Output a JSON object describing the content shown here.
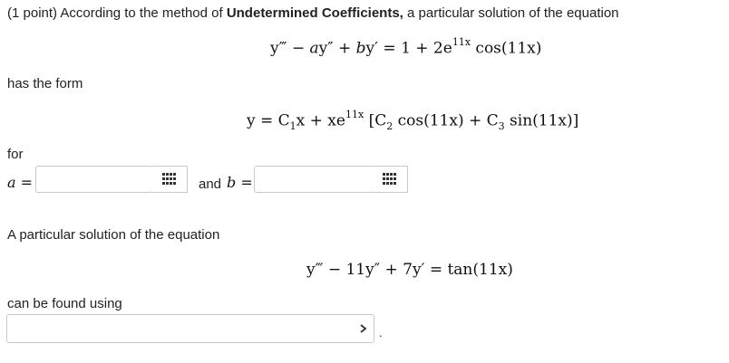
{
  "question": {
    "intro_points": "(1 point) According to the method of ",
    "intro_bold": "Undetermined Coefficients,",
    "intro_rest": " a particular solution of the equation",
    "eq1": {
      "lhs_a": "y‴ − ",
      "a": "a",
      "lhs_b": "y″ + ",
      "b": "b",
      "lhs_c": "y′ = 1 + 2e",
      "exp": "11x",
      "rhs": " cos(11x)"
    },
    "has_form": "has the form",
    "form": {
      "pre": "y = C",
      "sub1": "1",
      "mid1": "x + xe",
      "exp": "11x",
      "mid2": " [C",
      "sub2": "2",
      "mid3": " cos(11x) + C",
      "sub3": "3",
      "end": " sin(11x)]"
    },
    "for_label": "for",
    "a_label": "a =",
    "and_label": "and",
    "b_label": "b =",
    "a_value": "",
    "b_value": ""
  },
  "part2": {
    "prompt": "A particular solution of the equation",
    "eq2": "y‴ − 11y″ + 7y′ = tan(11x)",
    "found_using": "can be found using",
    "select_value": "",
    "trailing": "."
  },
  "icons": {
    "palette": "grid-palette-icon",
    "dropdown": "chevron-down-icon"
  },
  "colors": {
    "border": "#c8c8c8",
    "icon": "#333333"
  }
}
